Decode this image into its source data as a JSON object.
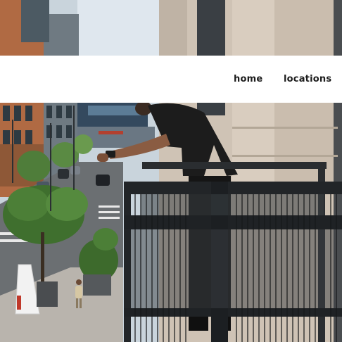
{
  "nav": {
    "items": [
      {
        "label": "home"
      },
      {
        "label": "locations"
      }
    ]
  },
  "hero": {
    "icon": "hero-photo-balcony-city-street"
  }
}
